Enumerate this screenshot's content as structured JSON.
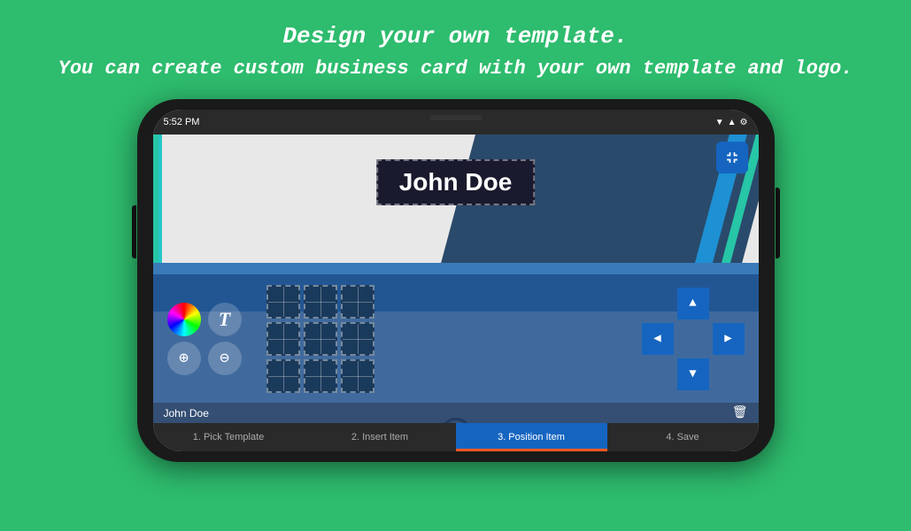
{
  "header": {
    "line1": "Design your own template.",
    "line2": "You can create custom business card with your own template and logo."
  },
  "status_bar": {
    "time": "5:52 PM",
    "icons": "▼ ▲ ⚙"
  },
  "card": {
    "name": "John Doe"
  },
  "name_bar": {
    "text": "John Doe"
  },
  "tabs": [
    {
      "label": "1. Pick Template",
      "active": false
    },
    {
      "label": "2. Insert Item",
      "active": false
    },
    {
      "label": "3. Position Item",
      "active": true
    },
    {
      "label": "4. Save",
      "active": false
    }
  ],
  "toolbar": {
    "text_label": "T",
    "zoom_in_label": "⊕",
    "zoom_out_label": "⊖"
  }
}
